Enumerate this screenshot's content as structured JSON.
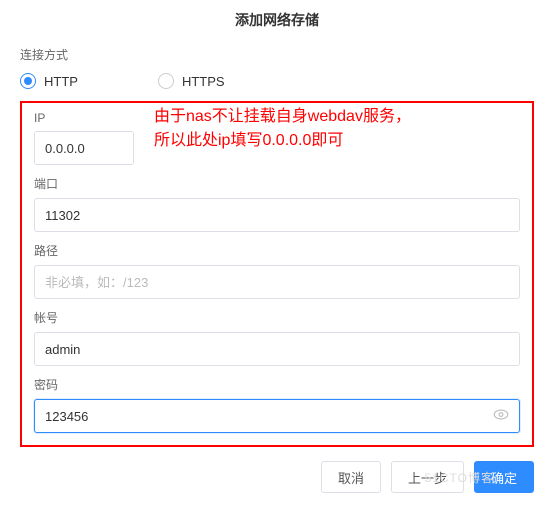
{
  "title": "添加网络存储",
  "connection": {
    "label": "连接方式",
    "options": {
      "http": "HTTP",
      "https": "HTTPS"
    },
    "selected": "http"
  },
  "form": {
    "ip": {
      "label": "IP",
      "value": "0.0.0.0"
    },
    "port": {
      "label": "端口",
      "value": "11302"
    },
    "path": {
      "label": "路径",
      "value": "",
      "placeholder": "非必填，如：/123"
    },
    "account": {
      "label": "帐号",
      "value": "admin"
    },
    "password": {
      "label": "密码",
      "value": "123456"
    }
  },
  "annotation": {
    "line1": "由于nas不让挂载自身webdav服务，",
    "line2": "所以此处ip填写0.0.0.0即可"
  },
  "buttons": {
    "cancel": "取消",
    "prev": "上一步",
    "ok": "确定"
  },
  "watermark": "51CTO博客"
}
